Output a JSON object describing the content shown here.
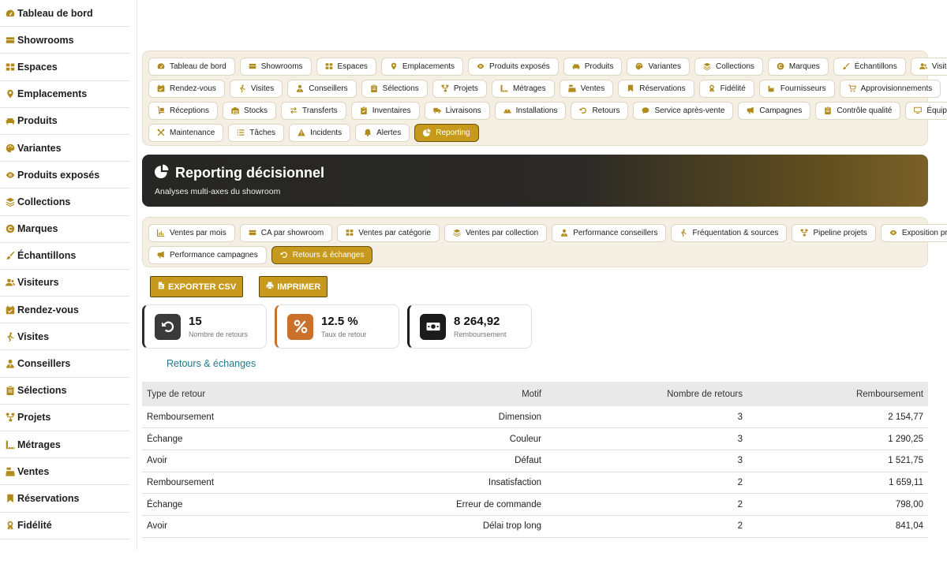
{
  "sidebar": {
    "items": [
      {
        "label": "Tableau de bord",
        "icon": "dashboard-icon"
      },
      {
        "label": "Showrooms",
        "icon": "showroom-icon"
      },
      {
        "label": "Espaces",
        "icon": "grid-icon"
      },
      {
        "label": "Emplacements",
        "icon": "location-pin-icon"
      },
      {
        "label": "Produits",
        "icon": "couch-icon"
      },
      {
        "label": "Variantes",
        "icon": "palette-icon"
      },
      {
        "label": "Produits exposés",
        "icon": "eye-icon"
      },
      {
        "label": "Collections",
        "icon": "layers-icon"
      },
      {
        "label": "Marques",
        "icon": "copyright-icon"
      },
      {
        "label": "Échantillons",
        "icon": "brush-icon"
      },
      {
        "label": "Visiteurs",
        "icon": "users-icon"
      },
      {
        "label": "Rendez-vous",
        "icon": "calendar-check-icon"
      },
      {
        "label": "Visites",
        "icon": "walking-icon"
      },
      {
        "label": "Conseillers",
        "icon": "user-tie-icon"
      },
      {
        "label": "Sélections",
        "icon": "clipboard-icon"
      },
      {
        "label": "Projets",
        "icon": "sitemap-icon"
      },
      {
        "label": "Métrages",
        "icon": "ruler-icon"
      },
      {
        "label": "Ventes",
        "icon": "cash-register-icon"
      },
      {
        "label": "Réservations",
        "icon": "bookmark-icon"
      },
      {
        "label": "Fidélité",
        "icon": "award-icon"
      }
    ]
  },
  "modules": {
    "rows": [
      [
        {
          "label": "Tableau de bord",
          "icon": "dashboard-icon"
        },
        {
          "label": "Showrooms",
          "icon": "showroom-icon"
        },
        {
          "label": "Espaces",
          "icon": "grid-icon"
        },
        {
          "label": "Emplacements",
          "icon": "location-pin-icon"
        },
        {
          "label": "Produits exposés",
          "icon": "eye-icon"
        },
        {
          "label": "Produits",
          "icon": "couch-icon"
        },
        {
          "label": "Variantes",
          "icon": "palette-icon"
        },
        {
          "label": "Collections",
          "icon": "layers-icon"
        },
        {
          "label": "Marques",
          "icon": "copyright-icon"
        },
        {
          "label": "Échantillons",
          "icon": "brush-icon"
        },
        {
          "label": "Visiteurs",
          "icon": "users-icon"
        }
      ],
      [
        {
          "label": "Rendez-vous",
          "icon": "calendar-check-icon"
        },
        {
          "label": "Visites",
          "icon": "walking-icon"
        },
        {
          "label": "Conseillers",
          "icon": "user-tie-icon"
        },
        {
          "label": "Sélections",
          "icon": "clipboard-icon"
        },
        {
          "label": "Projets",
          "icon": "sitemap-icon"
        },
        {
          "label": "Métrages",
          "icon": "ruler-icon"
        },
        {
          "label": "Ventes",
          "icon": "cash-register-icon"
        },
        {
          "label": "Réservations",
          "icon": "bookmark-icon"
        },
        {
          "label": "Fidélité",
          "icon": "award-icon"
        },
        {
          "label": "Fournisseurs",
          "icon": "industry-icon"
        },
        {
          "label": "Approvisionnements",
          "icon": "cart-icon"
        }
      ],
      [
        {
          "label": "Réceptions",
          "icon": "dolly-icon"
        },
        {
          "label": "Stocks",
          "icon": "warehouse-icon"
        },
        {
          "label": "Transferts",
          "icon": "exchange-icon"
        },
        {
          "label": "Inventaires",
          "icon": "clipboard-check-icon"
        },
        {
          "label": "Livraisons",
          "icon": "truck-icon"
        },
        {
          "label": "Installations",
          "icon": "hard-hat-icon"
        },
        {
          "label": "Retours",
          "icon": "undo-icon"
        },
        {
          "label": "Service après-vente",
          "icon": "comment-icon"
        },
        {
          "label": "Campagnes",
          "icon": "bullhorn-icon"
        },
        {
          "label": "Contrôle qualité",
          "icon": "clipboard-icon"
        },
        {
          "label": "Équipements",
          "icon": "monitor-icon"
        }
      ],
      [
        {
          "label": "Maintenance",
          "icon": "tools-icon"
        },
        {
          "label": "Tâches",
          "icon": "list-icon"
        },
        {
          "label": "Incidents",
          "icon": "warning-icon"
        },
        {
          "label": "Alertes",
          "icon": "bell-icon"
        },
        {
          "label": "Reporting",
          "icon": "pie-chart-icon",
          "active": true
        }
      ]
    ]
  },
  "hero": {
    "title": "Reporting décisionnel",
    "subtitle": "Analyses multi-axes du showroom",
    "icon": "pie-chart-icon"
  },
  "reports": {
    "rows": [
      [
        {
          "label": "Ventes par mois",
          "icon": "line-chart-icon"
        },
        {
          "label": "CA par showroom",
          "icon": "showroom-icon"
        },
        {
          "label": "Ventes par catégorie",
          "icon": "grid-icon"
        },
        {
          "label": "Ventes par collection",
          "icon": "layers-icon"
        },
        {
          "label": "Performance conseillers",
          "icon": "user-tie-icon"
        },
        {
          "label": "Fréquentation & sources",
          "icon": "walking-icon"
        },
        {
          "label": "Pipeline projets",
          "icon": "sitemap-icon"
        },
        {
          "label": "Exposition produits",
          "icon": "eye-icon"
        }
      ],
      [
        {
          "label": "Performance campagnes",
          "icon": "bullhorn-icon"
        },
        {
          "label": "Retours & échanges",
          "icon": "undo-icon",
          "active": true
        }
      ]
    ]
  },
  "actions": {
    "export_label": "EXPORTER CSV",
    "print_label": "IMPRIMER"
  },
  "kpis": [
    {
      "value": "15",
      "label": "Nombre de retours",
      "icon": "undo-icon",
      "color": "#3a3a3a",
      "border": "#2c2c2c"
    },
    {
      "value": "12.5 %",
      "label": "Taux de retour",
      "icon": "percent-icon",
      "color": "#c9702a",
      "border": "#c9702a"
    },
    {
      "value": "8 264,92",
      "label": "Remboursement",
      "icon": "money-bill-icon",
      "color": "#1b1b1b",
      "border": "#1b1b1b"
    }
  ],
  "section_title": "Retours & échanges",
  "table": {
    "headers": [
      "Type de retour",
      "Motif",
      "Nombre de retours",
      "Remboursement"
    ],
    "rows": [
      [
        "Remboursement",
        "Dimension",
        "3",
        "2 154,77"
      ],
      [
        "Échange",
        "Couleur",
        "3",
        "1 290,25"
      ],
      [
        "Avoir",
        "Défaut",
        "3",
        "1 521,75"
      ],
      [
        "Remboursement",
        "Insatisfaction",
        "2",
        "1 659,11"
      ],
      [
        "Échange",
        "Erreur de commande",
        "2",
        "798,00"
      ],
      [
        "Avoir",
        "Délai trop long",
        "2",
        "841,04"
      ]
    ]
  },
  "colors": {
    "accent": "#c79a1d",
    "icon": "#b08a1a",
    "teal": "#1f7a8c"
  }
}
